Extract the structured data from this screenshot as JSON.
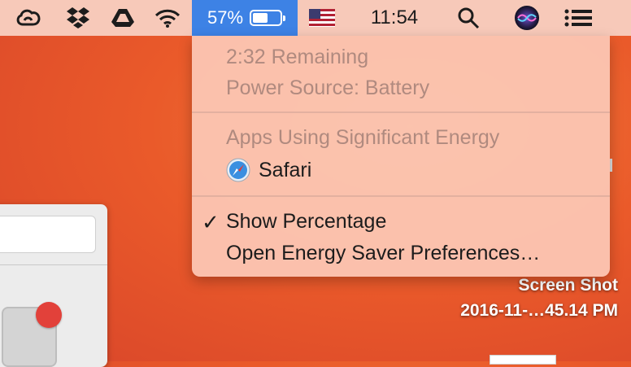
{
  "menubar": {
    "status_icons": [
      "creative-cloud-icon",
      "dropbox-icon",
      "google-drive-icon",
      "wifi-icon"
    ],
    "battery": {
      "percent_label": "57%",
      "level": 0.57
    },
    "clock": "11:54",
    "right_icons": [
      "spotlight-search-icon",
      "siri-icon",
      "notification-center-icon"
    ],
    "flag_icon": "us-flag-icon"
  },
  "battery_menu": {
    "time_remaining": "2:32 Remaining",
    "power_source": "Power Source: Battery",
    "apps_header": "Apps Using Significant Energy",
    "apps": [
      {
        "name": "Safari",
        "icon": "safari-icon"
      }
    ],
    "show_percentage": {
      "label": "Show Percentage",
      "checked": true,
      "check_mark": "✓"
    },
    "energy_saver": "Open Energy Saver Preferences…"
  },
  "desktop": {
    "file_name_line1": "Screen Shot",
    "file_name_line2": "2016-11-…45.14 PM"
  }
}
